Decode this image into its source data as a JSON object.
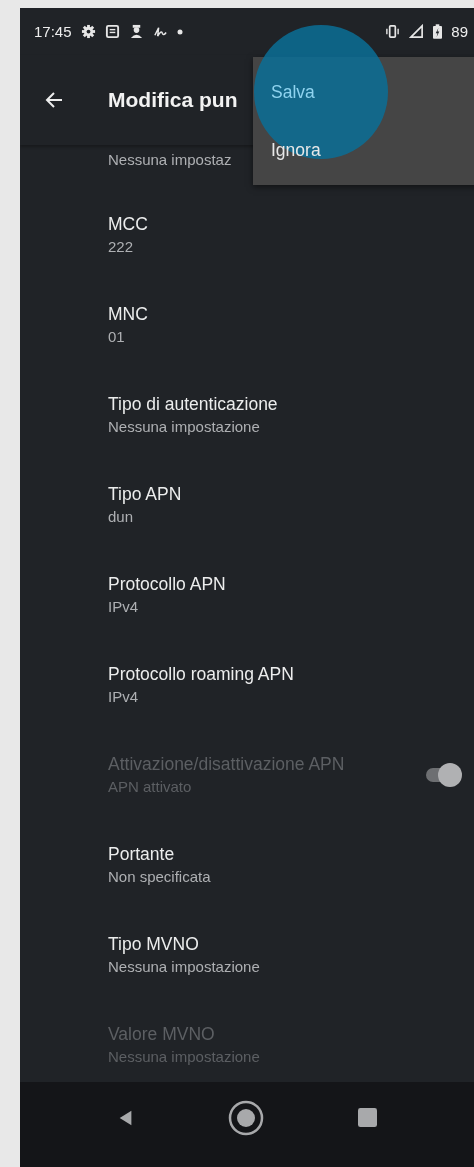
{
  "status_bar": {
    "time": "17:45",
    "battery": "89"
  },
  "app_bar": {
    "title": "Modifica pun"
  },
  "menu": {
    "items": [
      {
        "label": "Salva",
        "pressed": true
      },
      {
        "label": "Ignora",
        "pressed": false
      }
    ]
  },
  "settings": [
    {
      "kind": "partial",
      "summary": "Nessuna impostaz"
    },
    {
      "kind": "text",
      "title": "MCC",
      "summary": "222",
      "disabled": false
    },
    {
      "kind": "text",
      "title": "MNC",
      "summary": "01",
      "disabled": false
    },
    {
      "kind": "text",
      "title": "Tipo di autenticazione",
      "summary": "Nessuna impostazione",
      "disabled": false
    },
    {
      "kind": "text",
      "title": "Tipo APN",
      "summary": "dun",
      "disabled": false
    },
    {
      "kind": "text",
      "title": "Protocollo APN",
      "summary": "IPv4",
      "disabled": false
    },
    {
      "kind": "text",
      "title": "Protocollo roaming APN",
      "summary": "IPv4",
      "disabled": false
    },
    {
      "kind": "switch",
      "title": "Attivazione/disattivazione APN",
      "summary": "APN attivato",
      "disabled": true,
      "on": true
    },
    {
      "kind": "text",
      "title": "Portante",
      "summary": "Non specificata",
      "disabled": false
    },
    {
      "kind": "text",
      "title": "Tipo MVNO",
      "summary": "Nessuna impostazione",
      "disabled": false
    },
    {
      "kind": "text",
      "title": "Valore MVNO",
      "summary": "Nessuna impostazione",
      "disabled": true
    }
  ]
}
